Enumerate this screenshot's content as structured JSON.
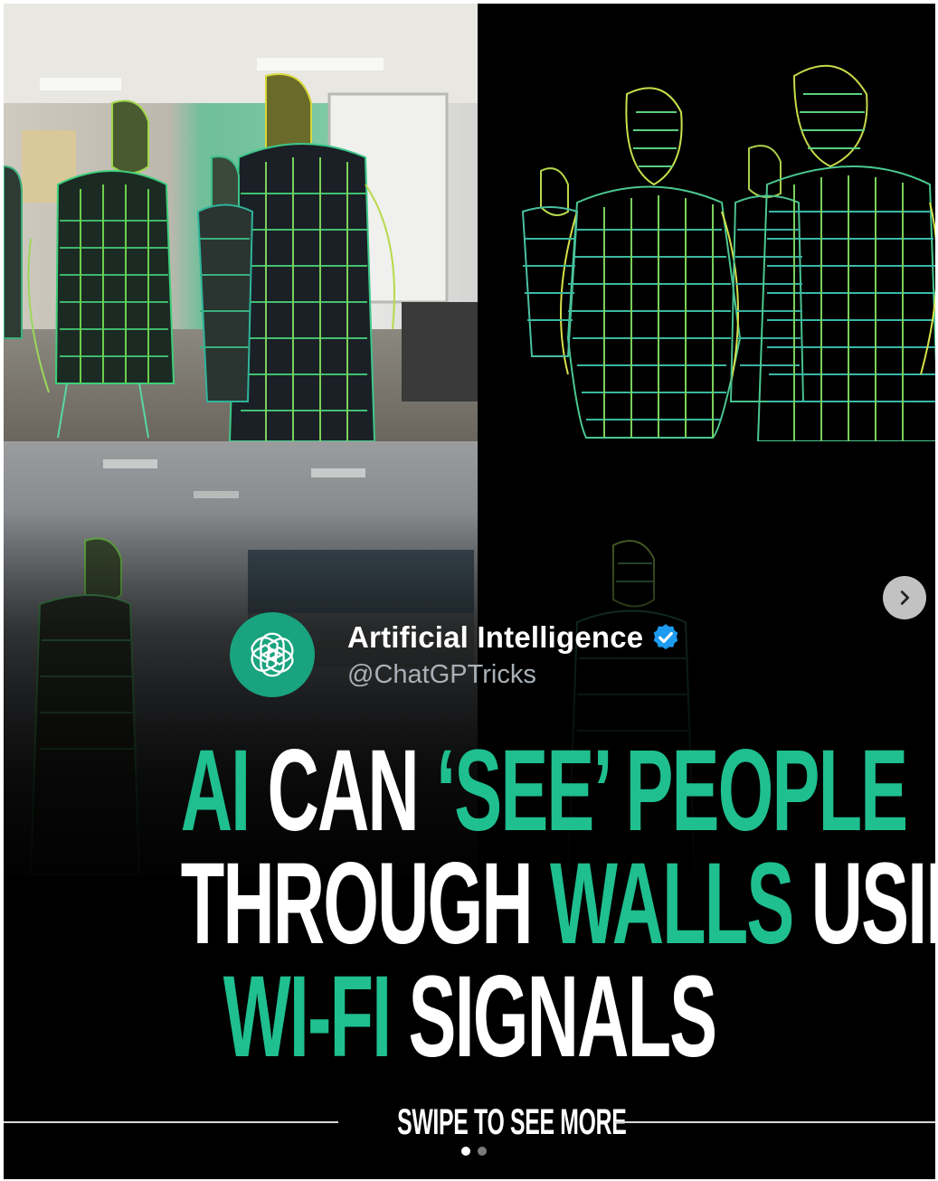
{
  "profile": {
    "name": "Artificial Intelligence",
    "handle": "@ChatGPTricks",
    "avatar_icon": "openai-logo-icon",
    "verified_icon": "verified-badge-icon"
  },
  "headline": {
    "line1": [
      {
        "text": "AI",
        "color": "green"
      },
      {
        "text": " CAN ",
        "color": "white"
      },
      {
        "text": "‘SEE’ PEOPLE",
        "color": "green"
      }
    ],
    "line2": [
      {
        "text": "THROUGH ",
        "color": "white"
      },
      {
        "text": "WALLS",
        "color": "green"
      },
      {
        "text": " USING",
        "color": "white"
      }
    ],
    "line3": [
      {
        "text": "WI-FI",
        "color": "green"
      },
      {
        "text": " SIGNALS",
        "color": "white"
      }
    ]
  },
  "swipe": {
    "label": "SWIPE TO SEE MORE",
    "dots": 2,
    "active_dot": 1
  },
  "navigation": {
    "next_icon": "chevron-right-icon"
  },
  "colors": {
    "accent_green": "#1fbf8f",
    "avatar_green": "#19a37f",
    "verified_blue": "#1d9bf0"
  }
}
